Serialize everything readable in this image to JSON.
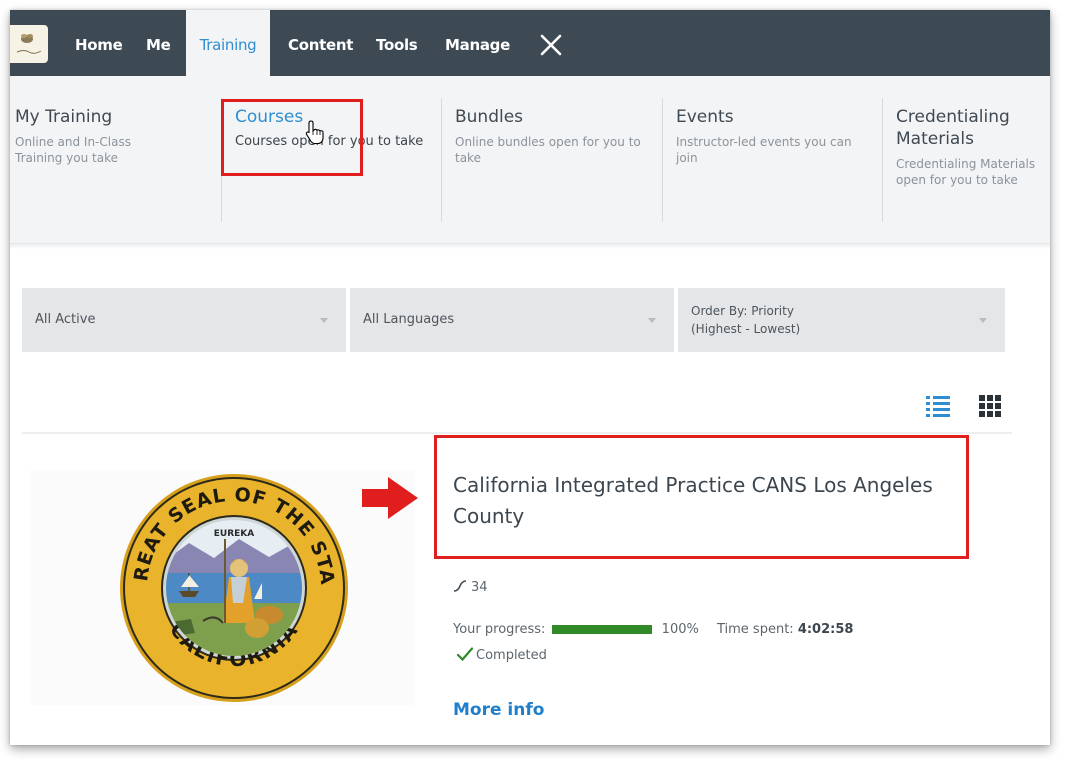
{
  "nav": {
    "home": "Home",
    "me": "Me",
    "training": "Training",
    "content": "Content",
    "tools": "Tools",
    "manage": "Manage",
    "close_icon": "close-x-icon",
    "logo_icon": "organization-logo-icon"
  },
  "training_menu": [
    {
      "title": "My Training",
      "desc": "Online and In-Class Training you take"
    },
    {
      "title": "Courses",
      "desc": "Courses open for you to take"
    },
    {
      "title": "Bundles",
      "desc": "Online bundles open for you to take"
    },
    {
      "title": "Events",
      "desc": "Instructor-led events you can join"
    },
    {
      "title": "Credentialing Materials",
      "desc": "Credentialing Materials open for you to take"
    }
  ],
  "filters": {
    "status": "All Active",
    "language": "All Languages",
    "order": "Order By: Priority (Highest - Lowest)"
  },
  "view_toggle": {
    "list_icon": "list-view-icon",
    "grid_icon": "grid-view-icon",
    "selected": "list"
  },
  "course": {
    "title": "California Integrated Practice CANS Los Angeles County",
    "image": "Great Seal of the State of California",
    "seal_top_text": "THE GREAT SEAL OF THE STATE OF",
    "seal_bottom_text": "CALIFORNIA",
    "seal_motto": "EUREKA",
    "rating_count": "34",
    "progress_label": "Your progress:",
    "progress_value": 1.0,
    "progress_text": "100%",
    "time_label": "Time spent:",
    "time_value": "4:02:58",
    "status": "Completed",
    "more_info": "More info"
  },
  "colors": {
    "nav_bg": "#3d4a54",
    "accent": "#2e8ed1",
    "highlight": "#e01e1e",
    "progress": "#2f8a27"
  }
}
